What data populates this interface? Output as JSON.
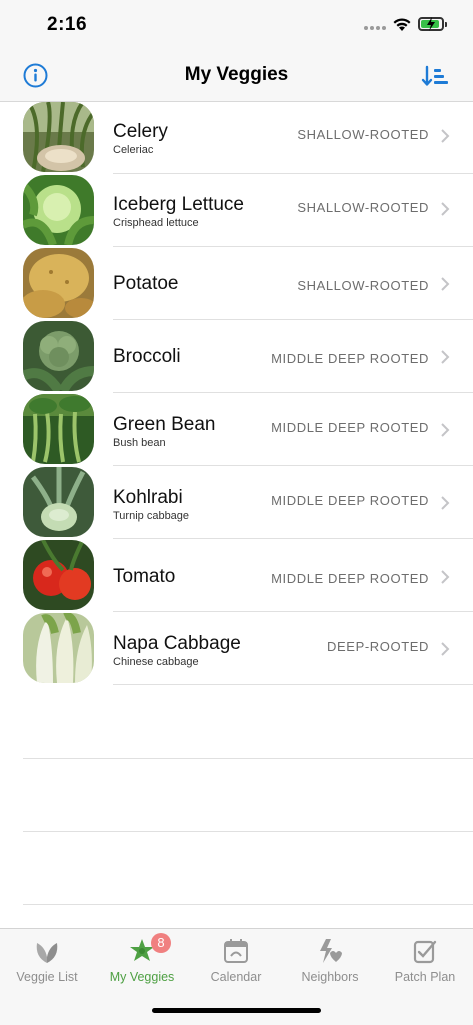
{
  "status": {
    "time": "2:16"
  },
  "nav": {
    "title": "My Veggies",
    "info_icon": "info-circle-icon",
    "sort_icon": "sort-descending-icon"
  },
  "veggies": [
    {
      "name": "Celery",
      "subtitle": "Celeriac",
      "root": "SHALLOW-ROOTED"
    },
    {
      "name": "Iceberg Lettuce",
      "subtitle": "Crisphead lettuce",
      "root": "SHALLOW-ROOTED"
    },
    {
      "name": "Potatoe",
      "subtitle": "",
      "root": "SHALLOW-ROOTED"
    },
    {
      "name": "Broccoli",
      "subtitle": "",
      "root": "MIDDLE DEEP ROOTED"
    },
    {
      "name": "Green Bean",
      "subtitle": "Bush bean",
      "root": "MIDDLE DEEP ROOTED"
    },
    {
      "name": "Kohlrabi",
      "subtitle": "Turnip cabbage",
      "root": "MIDDLE DEEP ROOTED"
    },
    {
      "name": "Tomato",
      "subtitle": "",
      "root": "MIDDLE DEEP ROOTED"
    },
    {
      "name": "Napa Cabbage",
      "subtitle": "Chinese cabbage",
      "root": "DEEP-ROOTED"
    }
  ],
  "tabs": [
    {
      "label": "Veggie List",
      "icon": "leaf-icon",
      "active": false
    },
    {
      "label": "My Veggies",
      "icon": "veggie-star-icon",
      "active": true,
      "badge": "8"
    },
    {
      "label": "Calendar",
      "icon": "calendar-icon",
      "active": false
    },
    {
      "label": "Neighbors",
      "icon": "neighbors-icon",
      "active": false
    },
    {
      "label": "Patch Plan",
      "icon": "patch-plan-icon",
      "active": false
    }
  ],
  "colors": {
    "accent": "#1e7bd6",
    "active_tab": "#4ea043",
    "badge": "#f08080"
  }
}
